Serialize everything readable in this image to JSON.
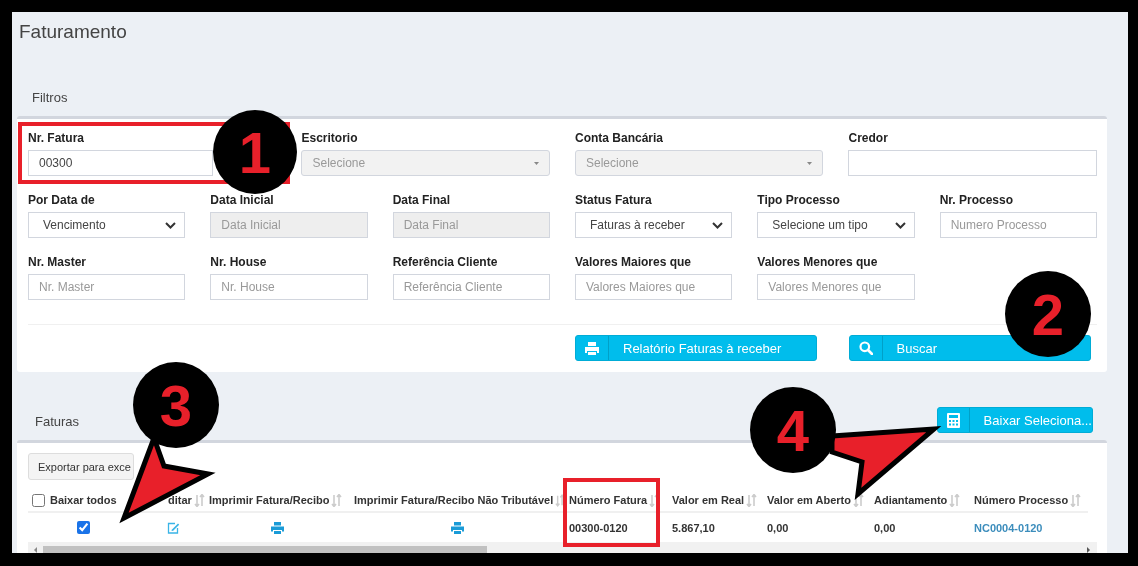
{
  "page": {
    "title": "Faturamento"
  },
  "filters": {
    "title": "Filtros",
    "fields": [
      {
        "label": "Nr. Fatura",
        "kind": "text",
        "value": "00300",
        "disabled": false
      },
      {
        "label": "Escritorio",
        "kind": "picker",
        "placeholder": "Selecione",
        "disabled": true
      },
      {
        "label": "Conta Bancária",
        "kind": "picker",
        "placeholder": "Selecione",
        "disabled": true
      },
      {
        "label": "Credor",
        "kind": "text",
        "disabled": false
      },
      {
        "label": "Por Data de",
        "kind": "select",
        "value": "Vencimento",
        "disabled": false
      },
      {
        "label": "Data Inicial",
        "kind": "text",
        "placeholder": "Data Inicial",
        "disabled": true
      },
      {
        "label": "Data Final",
        "kind": "text",
        "placeholder": "Data Final",
        "disabled": true
      },
      {
        "label": "Status Fatura",
        "kind": "select",
        "value": "Faturas à receber",
        "disabled": false
      },
      {
        "label": "Tipo Processo",
        "kind": "select",
        "value": "Selecione um tipo",
        "disabled": false
      },
      {
        "label": "Nr. Processo",
        "kind": "text",
        "placeholder": "Numero Processo",
        "disabled": false
      },
      {
        "label": "Nr. Master",
        "kind": "text",
        "placeholder": "Nr. Master",
        "disabled": false
      },
      {
        "label": "Nr. House",
        "kind": "text",
        "placeholder": "Nr. House",
        "disabled": false
      },
      {
        "label": "Referência Cliente",
        "kind": "text",
        "placeholder": "Referência Cliente",
        "disabled": false
      },
      {
        "label": "Valores Maiores que",
        "kind": "text",
        "placeholder": "Valores Maiores que",
        "disabled": false
      },
      {
        "label": "Valores Menores que",
        "kind": "text",
        "placeholder": "Valores Menores que",
        "disabled": false
      }
    ],
    "buttons": [
      {
        "label": "Relatório Faturas à receber"
      },
      {
        "label": "Buscar"
      }
    ]
  },
  "invoices": {
    "title": "Faturas",
    "action_button": {
      "label": "Baixar Seleciona..."
    },
    "export_button": "Exportar para exce",
    "columns": [
      {
        "label": "Baixar todos",
        "kind": "select-all",
        "checked": false,
        "sortable": false
      },
      {
        "label": "ditar",
        "kind": "text",
        "sortable": true
      },
      {
        "label": "Imprimir Fatura/Recibo",
        "kind": "text",
        "sortable": true
      },
      {
        "label": "Imprimir Fatura/Recibo Não Tributável",
        "kind": "text",
        "sortable": true
      },
      {
        "label": "Número Fatura",
        "kind": "text",
        "sortable": true
      },
      {
        "label": "Valor em Real",
        "kind": "text",
        "sortable": true
      },
      {
        "label": "Valor em Aberto",
        "kind": "text",
        "sortable": true
      },
      {
        "label": "Adiantamento",
        "kind": "text",
        "sortable": true
      },
      {
        "label": "Número Processo",
        "kind": "text",
        "sortable": true
      }
    ],
    "rows": [
      {
        "cells": [
          {
            "kind": "checkbox",
            "checked": true
          },
          {
            "kind": "edit"
          },
          {
            "kind": "print"
          },
          {
            "kind": "print"
          },
          {
            "kind": "text",
            "text": "00300-0120"
          },
          {
            "kind": "text",
            "text": "5.867,10"
          },
          {
            "kind": "text",
            "text": "0,00"
          },
          {
            "kind": "text",
            "text": "0,00"
          },
          {
            "kind": "link",
            "text": "NC0004-0120"
          }
        ]
      }
    ]
  },
  "annotations": [
    {
      "kind": "box"
    },
    {
      "kind": "badge",
      "label": "1"
    },
    {
      "kind": "badge",
      "label": "2"
    },
    {
      "kind": "arrow"
    },
    {
      "kind": "badge",
      "label": "3"
    },
    {
      "kind": "arrow"
    },
    {
      "kind": "badge",
      "label": "4"
    },
    {
      "kind": "box"
    }
  ]
}
